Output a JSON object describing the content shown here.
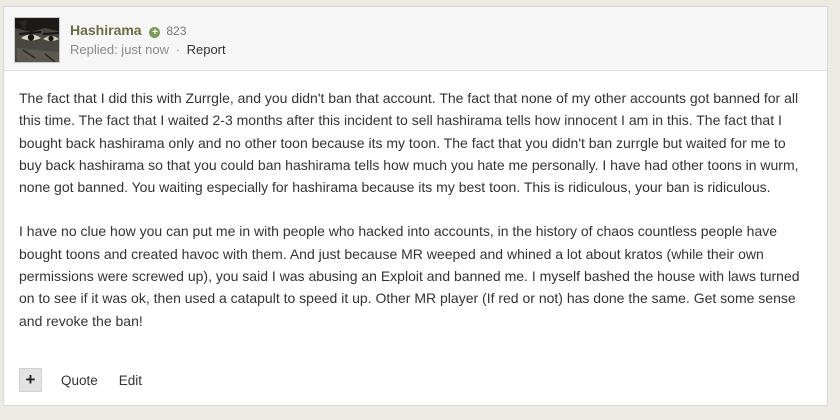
{
  "post": {
    "author": {
      "name": "Hashirama",
      "reputation": "823",
      "reputation_icon": "plus-circle-icon"
    },
    "meta": {
      "replied": "Replied: just now",
      "separator": "·",
      "report_label": "Report"
    },
    "paragraphs": [
      "The fact that I did this with Zurrgle, and you didn't ban that account. The fact that none of my other accounts got banned for all this time. The fact that I waited 2-3 months after this incident to sell hashirama tells how innocent I am in this. The fact that I bought back hashirama only and no other toon because its my toon. The fact that you didn't ban zurrgle but waited for me to buy back hashirama so that you could ban hashirama tells how much you hate me personally. I have had other toons in wurm, none got banned. You waiting especially for hashirama because its my best toon. This is ridiculous, your ban is ridiculous.",
      "I have no clue how you can put me in with people who hacked into accounts, in the history of chaos countless people have bought toons and created havoc with them. And just because MR weeped and whined a lot about kratos (while their own permissions were screwed up), you said I was abusing an Exploit and banned me. I myself bashed the house with laws turned on to see if it was ok, then used a catapult to speed it up. Other MR player (If red or not) has done the same. Get some sense and revoke the ban!"
    ],
    "footer": {
      "plus_label": "+",
      "quote_label": "Quote",
      "edit_label": "Edit"
    }
  },
  "colors": {
    "page_background": "#ebebe3",
    "author_name": "#6b6b47",
    "reputation_badge": "#7e9a5e",
    "body_text": "#333333"
  }
}
